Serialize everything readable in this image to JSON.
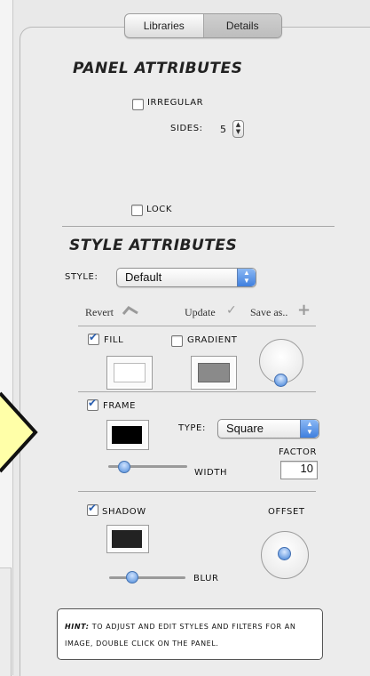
{
  "tabs": [
    {
      "label": "Libraries",
      "active": false
    },
    {
      "label": "Details",
      "active": true
    }
  ],
  "panel_attributes": {
    "title": "PANEL ATTRIBUTES",
    "irregular_label": "IRREGULAR",
    "irregular_checked": false,
    "sides_label": "SIDES:",
    "sides_value": "5",
    "lock_label": "LOCK",
    "lock_checked": false
  },
  "style_attributes": {
    "title": "STYLE ATTRIBUTES",
    "style_label": "STYLE:",
    "style_value": "Default",
    "revert_label": "Revert",
    "update_label": "Update",
    "save_label": "Save as..",
    "fill": {
      "label": "FILL",
      "checked": true,
      "color": "#ffffff"
    },
    "gradient": {
      "label": "GRADIENT",
      "checked": false,
      "color": "#8a8a8a"
    },
    "frame": {
      "label": "FRAME",
      "checked": true,
      "color": "#000000",
      "type_label": "TYPE:",
      "type_value": "Square",
      "factor_label": "FACTOR",
      "factor_value": "10",
      "width_label": "WIDTH"
    },
    "shadow": {
      "label": "SHADOW",
      "checked": true,
      "color": "#222222",
      "offset_label": "OFFSET",
      "blur_label": "BLUR"
    }
  },
  "hint": {
    "prefix": "HINT:",
    "text": " TO ADJUST AND EDIT STYLES AND FILTERS FOR AN IMAGE, DOUBLE CLICK ON THE PANEL."
  },
  "colors": {
    "pointer_fill": "#ffffa8",
    "accent_blue": "#3f7fde"
  }
}
